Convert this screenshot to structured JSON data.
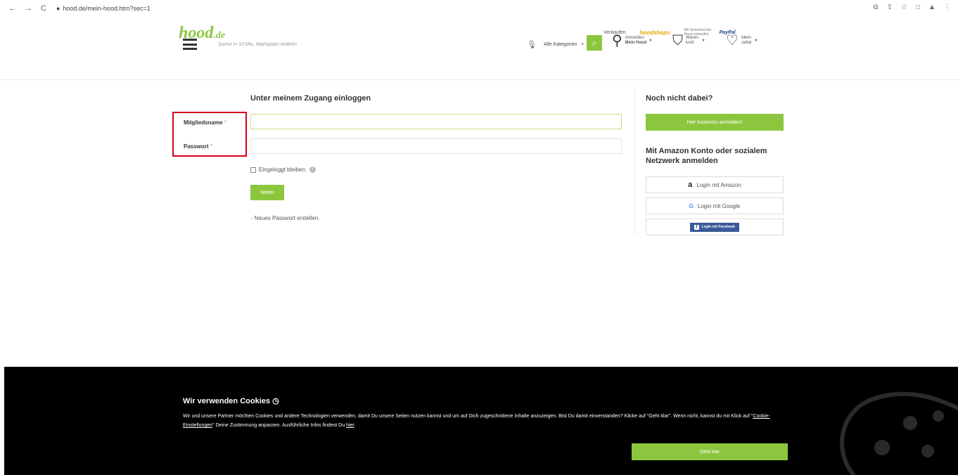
{
  "browser": {
    "back": "←",
    "forward": "→",
    "reload": "C",
    "url": "hood.de/mein-hood.htm?sec=1"
  },
  "header": {
    "logo_text": "hood",
    "logo_tld": ".de",
    "links": {
      "verkaufen": "Verkaufen",
      "hoodshops": "hoodshops",
      "paypal_note": "Mit Sicherheit bei Hood einkaufen",
      "paypal": "PayPal"
    },
    "search": {
      "placeholder": "Suche in 10 Mio. Marktplatz-Artikeln",
      "category": "Alle Kategorien"
    },
    "account": {
      "line1": "Anmelden",
      "line2": "Mein Hood"
    },
    "cart": {
      "line1": "Waren-",
      "line2": "korb"
    },
    "wishlist": {
      "line1": "Merk-",
      "line2": "zettel"
    }
  },
  "login": {
    "heading": "Unter meinem Zugang einloggen",
    "username_label": "Mitgliedsname",
    "password_label": "Passwort",
    "required_mark": "*",
    "username_value": "",
    "password_value": "",
    "stay_logged_in": "Eingeloggt bleiben.",
    "submit": "Weiter",
    "new_password": "Neues Passwort erstellen."
  },
  "register": {
    "heading": "Noch nicht dabei?",
    "button": "Hier kostenlos anmelden!",
    "social_heading": "Mit Amazon Konto oder sozialem Netzwerk anmelden",
    "amazon": "Login mit Amazon",
    "google": "Login mit Google",
    "facebook": "Login mit Facebook"
  },
  "cookie": {
    "title": "Wir verwenden Cookies",
    "text_part1": "Wir und unsere Partner möchten Cookies und andere Technologien verwenden, damit Du unsere Seiten nutzen kannst und um auf Dich zugeschnittene Inhalte anzuzeigen. Bist Du damit einverstanden? Klicke auf \"Geht klar\". Wenn nicht, kannst du mit Klick auf \"",
    "settings_link": "Cookie-Einstellungen",
    "text_part2": "\" Deine Zustimmung anpassen. Ausführliche Infos findest Du ",
    "here_link": "hier",
    "text_part3": ".",
    "accept": "Geht klar"
  }
}
